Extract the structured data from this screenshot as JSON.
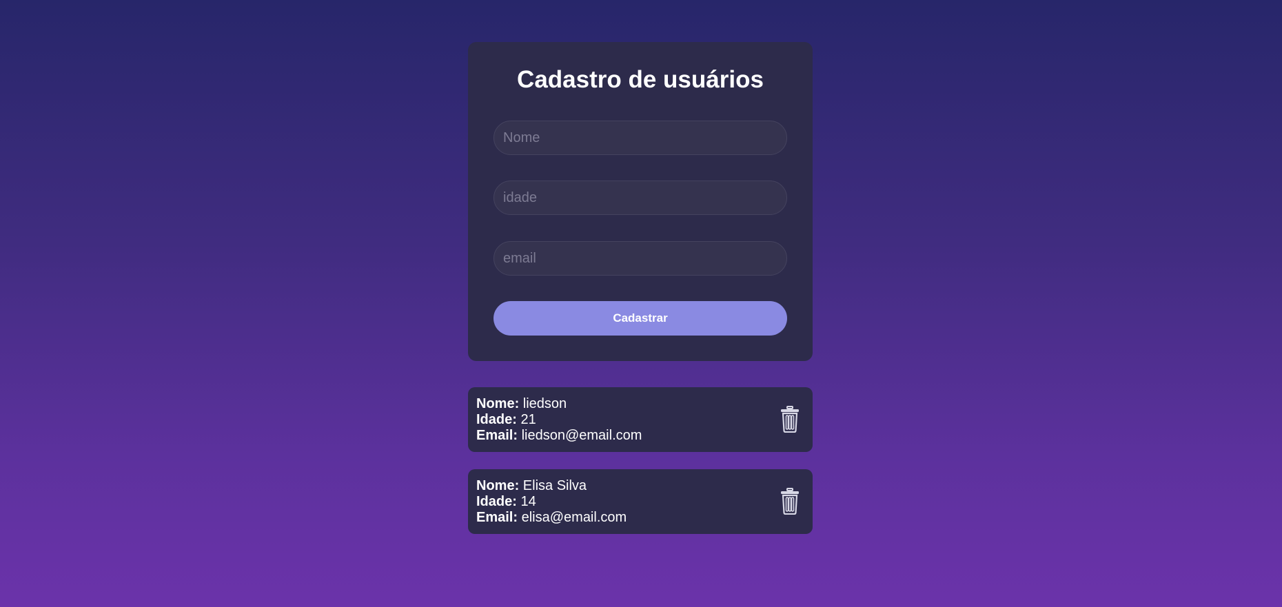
{
  "form": {
    "title": "Cadastro de usuários",
    "name_placeholder": "Nome",
    "age_placeholder": "idade",
    "email_placeholder": "email",
    "submit_label": "Cadastrar"
  },
  "labels": {
    "name": "Nome:",
    "age": "Idade:",
    "email": "Email:"
  },
  "users": [
    {
      "name": "liedson",
      "age": "21",
      "email": "liedson@email.com"
    },
    {
      "name": "Elisa Silva",
      "age": "14",
      "email": "elisa@email.com"
    }
  ],
  "icons": {
    "delete": "trash-icon"
  },
  "colors": {
    "card_bg": "#2d2b4b",
    "button_bg": "#8a8ae2",
    "gradient_top": "#27266a",
    "gradient_bottom": "#6b33aa"
  }
}
